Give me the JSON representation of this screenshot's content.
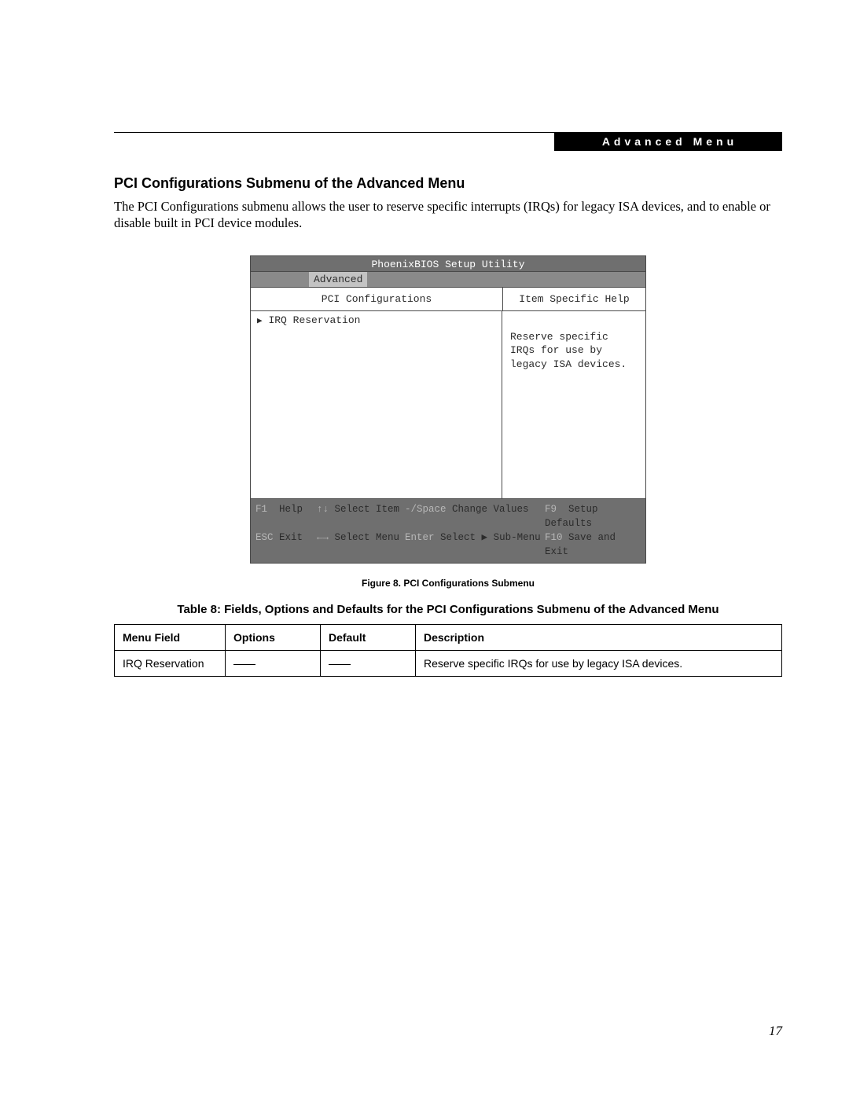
{
  "header_tab": "Advanced Menu",
  "section_title": "PCI Configurations Submenu of the Advanced Menu",
  "intro_paragraph": "The PCI Configurations submenu allows the user to reserve specific interrupts (IRQs) for legacy ISA devices, and to enable or disable built in PCI device modules.",
  "bios": {
    "title": "PhoenixBIOS Setup Utility",
    "active_tab": "Advanced",
    "left_heading": "PCI Configurations",
    "right_heading": "Item Specific Help",
    "left_item": "IRQ Reservation",
    "help_text": "Reserve specific IRQs for use by legacy ISA devices.",
    "footer": {
      "r1c1_key": "F1",
      "r1c1_label": "Help",
      "r1c2_key": "↑↓",
      "r1c2_label": "Select Item",
      "r1c3_key": "-/Space",
      "r1c3_label": "Change Values",
      "r1c4_key": "F9",
      "r1c4_label": "Setup Defaults",
      "r2c1_key": "ESC",
      "r2c1_label": "Exit",
      "r2c2_key": "←→",
      "r2c2_label": "Select Menu",
      "r2c3_key": "Enter",
      "r2c3_label": "Select ▶ Sub-Menu",
      "r2c4_key": "F10",
      "r2c4_label": "Save and Exit"
    }
  },
  "figure_caption": "Figure 8.  PCI Configurations Submenu",
  "table_title": "Table 8: Fields, Options and Defaults for the PCI Configurations Submenu of the Advanced Menu",
  "table": {
    "headers": {
      "c1": "Menu Field",
      "c2": "Options",
      "c3": "Default",
      "c4": "Description"
    },
    "row1": {
      "c1": "IRQ Reservation",
      "c4": "Reserve specific IRQs for use by legacy ISA devices."
    }
  },
  "page_number": "17"
}
